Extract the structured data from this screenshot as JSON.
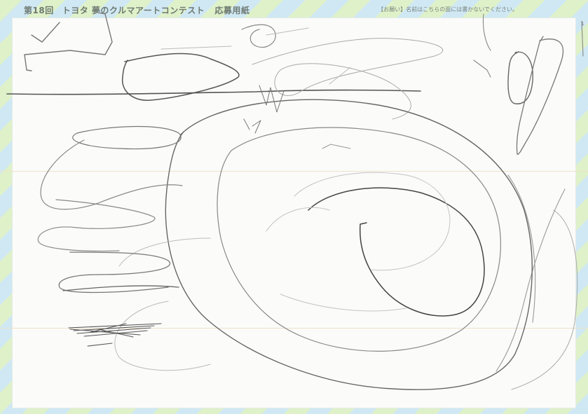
{
  "header": {
    "round": "第18回",
    "contest": "トヨタ 夢のクルマアートコンテスト",
    "form": "応募用紙"
  },
  "notice": "【お願い】名前はこちらの面には書かないでください。",
  "corner_mark": "1"
}
